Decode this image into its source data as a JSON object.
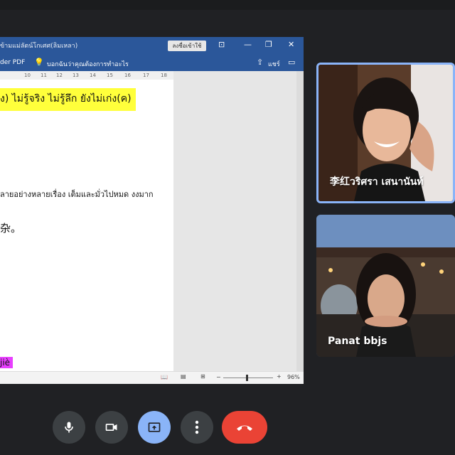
{
  "word": {
    "doc_title": "ข้ามแม่ลัตน์โกเศศ(ลิมเหลา)",
    "title_button": "ลงชื่อเข้าใช้",
    "ribbon_pdf": "der PDF",
    "ribbon_tellme": "บอกฉันว่าคุณต้องการทำอะไร",
    "ribbon_share": "แชร์",
    "ruler_marks": [
      "10",
      "11",
      "12",
      "13",
      "14",
      "15",
      "16",
      "17",
      "18"
    ],
    "lines": {
      "line1": "ง) ไม่รู้จริง ไม่รู้ลึก ยังไม่เก่ง(ค)",
      "line2": "ลายอย่างหลายเรื่อง เต็มและมั่วไปหมด งงมาก",
      "line3": "杂。",
      "line4": "jiè"
    },
    "zoom": "96%"
  },
  "participants": [
    {
      "name": "李红วริศรา เสนานันท์"
    },
    {
      "name": "Panat bbjs"
    }
  ],
  "controls": {
    "mic": "microphone-icon",
    "camera": "camera-icon",
    "present": "present-screen-icon",
    "more": "more-vertical-icon",
    "end": "hang-up-icon"
  },
  "colors": {
    "word_blue": "#2b579a",
    "highlight_yellow": "#ffff3b",
    "highlight_pink": "#e83fff",
    "active_tile_border": "#8ab4f8",
    "end_call": "#ea4335",
    "background": "#202124"
  }
}
